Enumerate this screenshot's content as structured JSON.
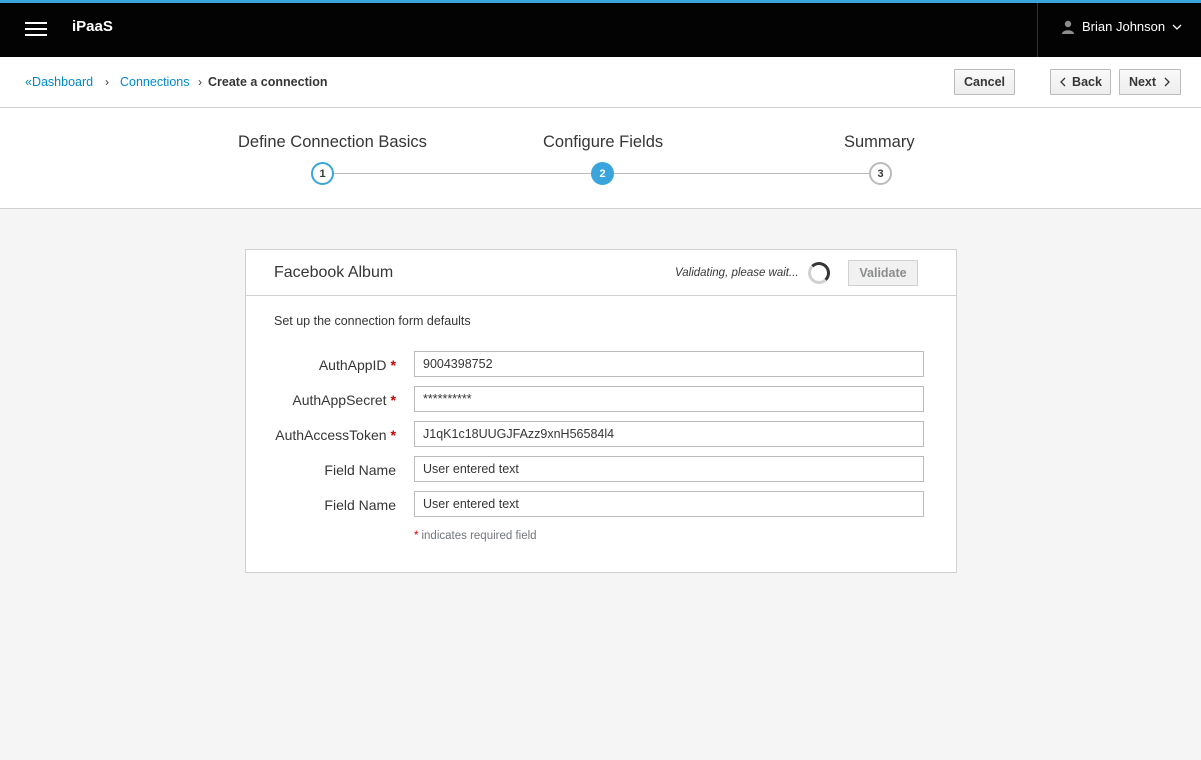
{
  "app": {
    "brand": "iPaaS",
    "user_name": "Brian Johnson"
  },
  "breadcrumb": {
    "dashboard": "Dashboard",
    "connections": "Connections",
    "current": "Create a connection",
    "back_glyph": "«",
    "sep_glyph": "›"
  },
  "actions": {
    "cancel": "Cancel",
    "back": "Back",
    "next": "Next"
  },
  "wizard": {
    "steps": [
      {
        "title": "Define Connection Basics",
        "number": "1",
        "state": "completed"
      },
      {
        "title": "Configure Fields",
        "number": "2",
        "state": "active"
      },
      {
        "title": "Summary",
        "number": "3",
        "state": "pending"
      }
    ]
  },
  "card": {
    "title": "Facebook Album",
    "status": "Validating, please wait...",
    "validate_label": "Validate",
    "description": "Set up the connection form defaults",
    "fields": [
      {
        "label": "AuthAppID",
        "required": true,
        "value": "9004398752"
      },
      {
        "label": "AuthAppSecret",
        "required": true,
        "value": "**********"
      },
      {
        "label": "AuthAccessToken",
        "required": true,
        "value": "J1qK1c18UUGJFAzz9xnH56584l4"
      },
      {
        "label": "Field Name",
        "required": false,
        "value": "User entered text"
      },
      {
        "label": "Field Name",
        "required": false,
        "value": "User entered text"
      }
    ],
    "required_star": "*",
    "required_note": "indicates required field"
  },
  "colors": {
    "accent": "#39a5dc",
    "link": "#0088ce",
    "required": "#cc0000",
    "topbar": "#030303"
  },
  "icons": [
    "hamburger-menu-icon",
    "user-icon",
    "chevron-down-icon",
    "chevron-left-icon",
    "chevron-right-icon",
    "spinner-icon"
  ]
}
